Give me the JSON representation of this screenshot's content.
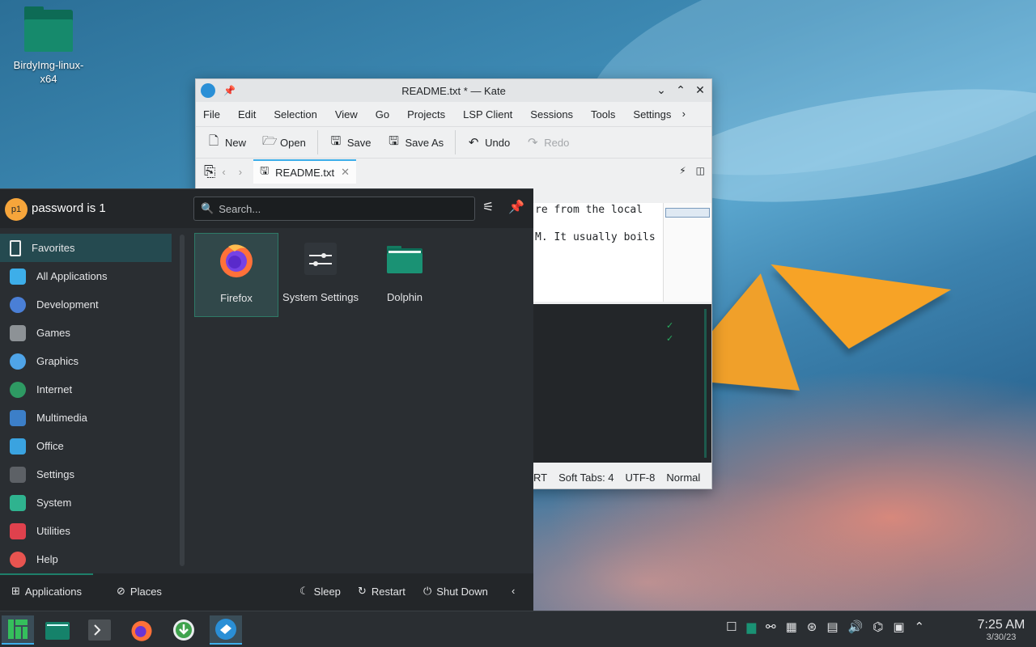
{
  "desktop": {
    "icon_label": "BirdyImg-linux-x64"
  },
  "kate": {
    "title": "README.txt * — Kate",
    "menu": [
      "File",
      "Edit",
      "Selection",
      "View",
      "Go",
      "Projects",
      "LSP Client",
      "Sessions",
      "Tools",
      "Settings"
    ],
    "toolbar": {
      "new": "New",
      "open": "Open",
      "save": "Save",
      "save_as": "Save As",
      "undo": "Undo",
      "redo": "Redo"
    },
    "tab_label": "README.txt",
    "editor_lines": [
      "re from the local",
      "M. It usually boils"
    ],
    "status": {
      "ins": "RT",
      "tabs": "Soft Tabs: 4",
      "encoding": "UTF-8",
      "mode": "Normal"
    }
  },
  "launcher": {
    "avatar_text": "p1",
    "user": "password is 1",
    "search_placeholder": "Search...",
    "categories": [
      {
        "label": "Favorites",
        "color": "#232629"
      },
      {
        "label": "All Applications",
        "color": "#3daee9"
      },
      {
        "label": "Development",
        "color": "#4a7fd6"
      },
      {
        "label": "Games",
        "color": "#8d9296"
      },
      {
        "label": "Graphics",
        "color": "#4fa4e8"
      },
      {
        "label": "Internet",
        "color": "#2e9a63"
      },
      {
        "label": "Multimedia",
        "color": "#3c7fc8"
      },
      {
        "label": "Office",
        "color": "#3aa3e0"
      },
      {
        "label": "Settings",
        "color": "#5d6166"
      },
      {
        "label": "System",
        "color": "#2fb38f"
      },
      {
        "label": "Utilities",
        "color": "#e0414d"
      },
      {
        "label": "Help",
        "color": "#e85450"
      }
    ],
    "apps": [
      {
        "label": "Firefox"
      },
      {
        "label": "System Settings"
      },
      {
        "label": "Dolphin"
      }
    ],
    "footer": {
      "applications": "Applications",
      "places": "Places",
      "sleep": "Sleep",
      "restart": "Restart",
      "shutdown": "Shut Down"
    }
  },
  "taskbar": {
    "time": "7:25 AM",
    "date": "3/30/23"
  },
  "colors": {
    "accent": "#3daee9",
    "panel": "#2a2e32",
    "selection": "#1e7f6a"
  }
}
